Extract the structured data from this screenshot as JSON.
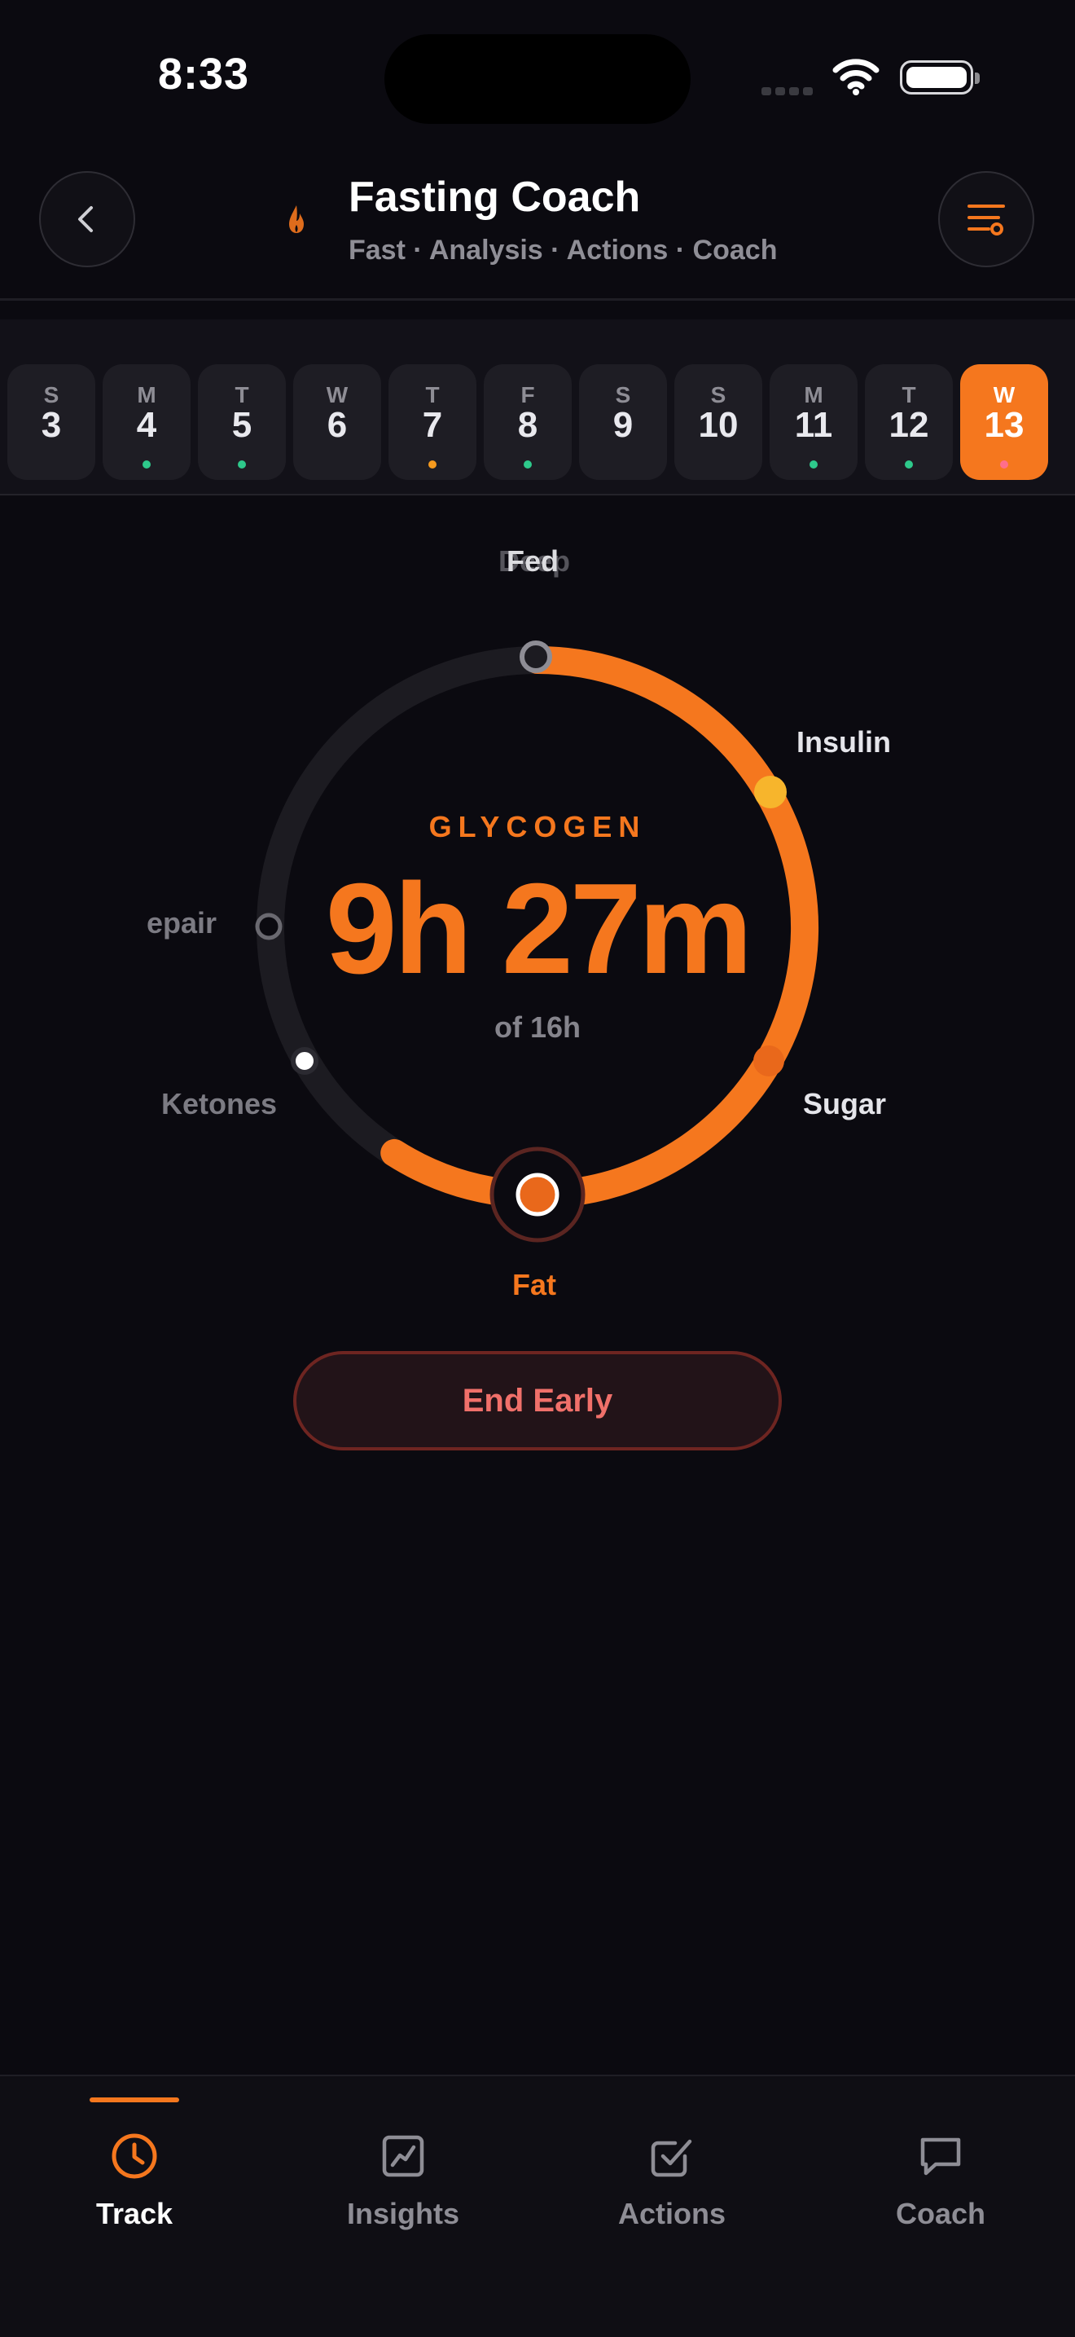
{
  "status_bar": {
    "time": "8:33"
  },
  "header": {
    "title": "Fasting Coach",
    "subtitle": "Fast · Analysis · Actions · Coach",
    "accent": "#f5771e"
  },
  "date_strip": {
    "days": [
      {
        "weekday": "S",
        "day": "3",
        "dot": ""
      },
      {
        "weekday": "M",
        "day": "4",
        "dot": "#2ec98b"
      },
      {
        "weekday": "T",
        "day": "5",
        "dot": "#2ec98b"
      },
      {
        "weekday": "W",
        "day": "6",
        "dot": ""
      },
      {
        "weekday": "T",
        "day": "7",
        "dot": "#f59a1e"
      },
      {
        "weekday": "F",
        "day": "8",
        "dot": "#2ec98b"
      },
      {
        "weekday": "S",
        "day": "9",
        "dot": ""
      },
      {
        "weekday": "S",
        "day": "10",
        "dot": ""
      },
      {
        "weekday": "M",
        "day": "11",
        "dot": "#2ec98b"
      },
      {
        "weekday": "T",
        "day": "12",
        "dot": "#2ec98b"
      },
      {
        "weekday": "W",
        "day": "13",
        "dot": "#ff6e8a",
        "selected": true
      }
    ]
  },
  "timer": {
    "phase": "GLYCOGEN",
    "elapsed": "9h 27m",
    "goal": "of 16h",
    "progress": 0.59,
    "stage_labels": {
      "top": "Fed",
      "top_ghost": "Deep",
      "insulin": "Insulin",
      "sugar": "Sugar",
      "fat": "Fat",
      "ketones": "Ketones",
      "repair": "epair"
    }
  },
  "actions": {
    "end_early": "End Early"
  },
  "tabbar": {
    "tabs": [
      {
        "label": "Track",
        "icon": "clock-icon",
        "active": true
      },
      {
        "label": "Insights",
        "icon": "chart-icon"
      },
      {
        "label": "Actions",
        "icon": "checkbox-icon"
      },
      {
        "label": "Coach",
        "icon": "chat-icon"
      }
    ]
  }
}
